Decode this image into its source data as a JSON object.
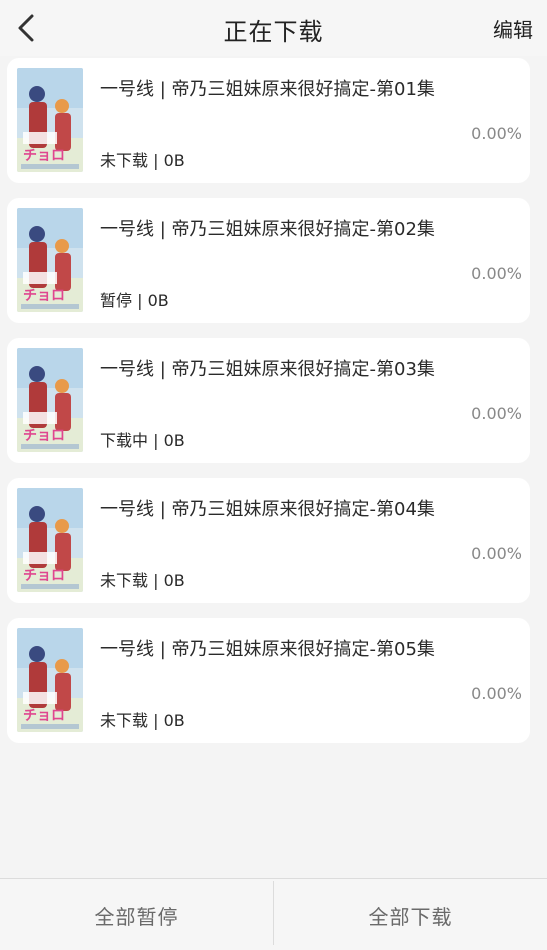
{
  "header": {
    "title": "正在下载",
    "edit_label": "编辑",
    "back_icon": "chevron-left-icon"
  },
  "downloads": [
    {
      "title": "一号线 | 帝乃三姐妹原来很好搞定-第01集",
      "status": "未下载 | 0B",
      "progress": "0.00%"
    },
    {
      "title": "一号线 | 帝乃三姐妹原来很好搞定-第02集",
      "status": "暂停 | 0B",
      "progress": "0.00%"
    },
    {
      "title": "一号线 | 帝乃三姐妹原来很好搞定-第03集",
      "status": "下载中 | 0B",
      "progress": "0.00%"
    },
    {
      "title": "一号线 | 帝乃三姐妹原来很好搞定-第04集",
      "status": "未下载 | 0B",
      "progress": "0.00%"
    },
    {
      "title": "一号线 | 帝乃三姐妹原来很好搞定-第05集",
      "status": "未下载 | 0B",
      "progress": "0.00%"
    }
  ],
  "footer": {
    "pause_all_label": "全部暂停",
    "download_all_label": "全部下载"
  },
  "colors": {
    "background": "#f4f4f4",
    "card": "#ffffff",
    "progress_text": "#888888",
    "footer_text": "#6a6a6a"
  }
}
